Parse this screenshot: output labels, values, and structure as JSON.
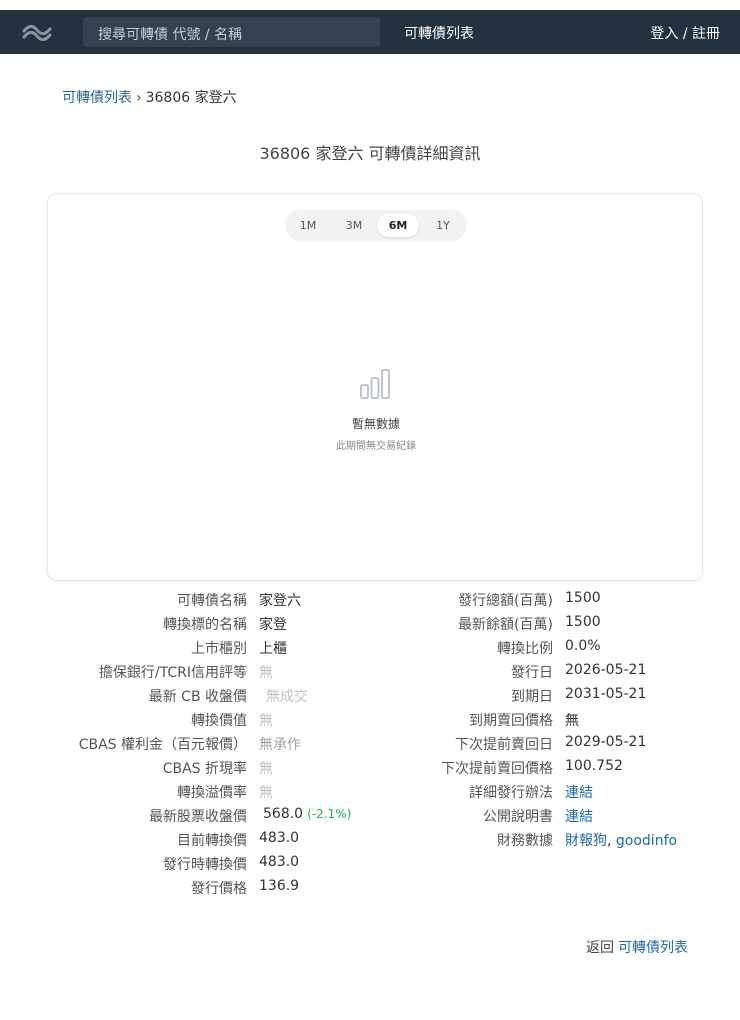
{
  "nav": {
    "search_placeholder": "搜尋可轉債 代號 / 名稱",
    "list_link": "可轉債列表",
    "login": "登入 / 註冊"
  },
  "breadcrumb": {
    "root": "可轉債列表",
    "separator": "›",
    "current": "36806 家登六"
  },
  "page_title": "36806 家登六 可轉債詳細資訊",
  "chart": {
    "ranges": [
      "1M",
      "3M",
      "6M",
      "1Y"
    ],
    "active_range": "6M",
    "empty_title": "暫無數據",
    "empty_sub": "此期間無交易紀錄",
    "empty_icon": "bar-chart-icon"
  },
  "details_left": [
    {
      "label": "可轉債名稱",
      "value": "家登六"
    },
    {
      "label": "轉換標的名稱",
      "value": "家登"
    },
    {
      "label": "上市櫃別",
      "value": "上櫃"
    },
    {
      "label": "擔保銀行/TCRI信用評等",
      "value": "無"
    },
    {
      "label": "最新 CB 收盤價",
      "value": "無成交"
    },
    {
      "label": "轉換價值",
      "value": "無"
    },
    {
      "label": "CBAS 權利金（百元報價）",
      "value": "無承作"
    },
    {
      "label": "CBAS 折現率",
      "value": "無"
    },
    {
      "label": "轉換溢價率",
      "value": "無"
    },
    {
      "label": "最新股票收盤價",
      "value": "568.0",
      "change": "(-2.1%)"
    },
    {
      "label": "目前轉換價",
      "value": "483.0"
    },
    {
      "label": "發行時轉換價",
      "value": "483.0"
    },
    {
      "label": "發行價格",
      "value": "136.9"
    }
  ],
  "details_right": [
    {
      "label": "發行總額(百萬)",
      "value": "1500"
    },
    {
      "label": "最新餘額(百萬)",
      "value": "1500"
    },
    {
      "label": "轉換比例",
      "value": "0.0%"
    },
    {
      "label": "發行日",
      "value": "2026-05-21"
    },
    {
      "label": "到期日",
      "value": "2031-05-21"
    },
    {
      "label": "到期賣回價格",
      "value": "無"
    },
    {
      "label": "下次提前賣回日",
      "value": "2029-05-21"
    },
    {
      "label": "下次提前賣回價格",
      "value": "100.752"
    },
    {
      "label": "詳細發行辦法",
      "link": "連結"
    },
    {
      "label": "公開說明書",
      "link": "連結"
    },
    {
      "label": "財務數據",
      "link": "財報狗",
      "link_sep": ", ",
      "link2": "goodinfo"
    }
  ],
  "footer": {
    "back": "返回",
    "link": "可轉債列表"
  },
  "colors": {
    "nav_bg": "#243240",
    "link": "#1f6aa5",
    "positive_change": "#2bb24c",
    "muted": "#c0c4c8"
  }
}
